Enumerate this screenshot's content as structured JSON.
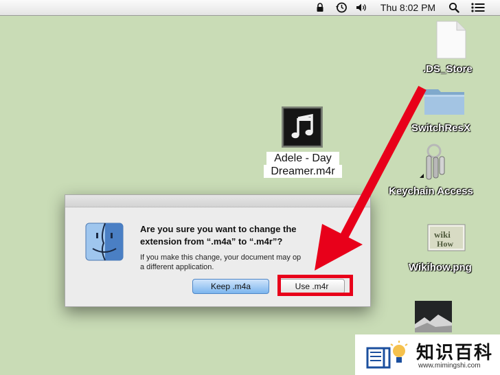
{
  "menubar": {
    "clock": "Thu 8:02 PM",
    "icons": [
      "lock-icon",
      "time-machine-icon",
      "volume-icon",
      "spotlight-icon",
      "notification-list-icon"
    ]
  },
  "desktop": {
    "icons": [
      {
        "label": ".DS_Store",
        "icon": "document-icon"
      },
      {
        "label": "SwitchResX",
        "icon": "folder-icon"
      },
      {
        "label": "Keychain Access",
        "icon": "keychain-icon"
      },
      {
        "label": "Wikihow.png",
        "icon": "image-file-icon"
      }
    ],
    "music_file": {
      "line1": "Adele - Day",
      "line2": "Dreamer.m4r",
      "icon": "music-note-icon"
    }
  },
  "dialog": {
    "title_line1": "Are you sure you want to change the",
    "title_line2": "extension from “.m4a” to “.m4r”?",
    "info_line1": "If you make this change, your document may op",
    "info_line2": "a different application.",
    "keep_label": "Keep .m4a",
    "use_label": "Use .m4r",
    "icon": "finder-icon"
  },
  "annotation": {
    "color": "#e8001a"
  },
  "watermark": {
    "text": "知识百科",
    "url": "www.mimingshi.com"
  }
}
